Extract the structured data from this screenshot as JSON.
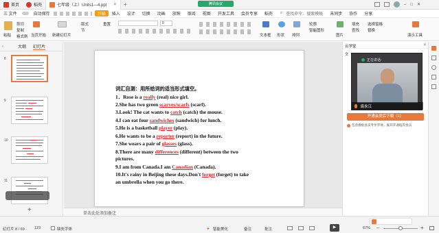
{
  "titlebar": {
    "tabs": [
      {
        "label": "首页",
        "color": "#d33b2f"
      },
      {
        "label": "稻壳",
        "color": "#d33b2f"
      },
      {
        "label": "七年级（上）Units1—4.ppt",
        "color": "#e8793a"
      }
    ],
    "meeting_label": "腾讯会议",
    "login_label": "登录"
  },
  "menubar": {
    "file": "三 文件",
    "quick_tools": "自动保存",
    "items": [
      "开始",
      "插入",
      "设计",
      "切换",
      "动画",
      "放映",
      "审阅",
      "视图",
      "开发工具",
      "会员专享",
      "稻壳"
    ],
    "active": "开始",
    "search": "查找命令、搜索模板",
    "unsync": "未同步",
    "collab": "协作",
    "share": "分享"
  },
  "ribbon": {
    "paste": "粘贴",
    "cut": "剪切",
    "copy": "复制",
    "format_painter": "格式刷",
    "from_current": "当页开始",
    "new_slide": "新建幻灯片",
    "layout": "版式",
    "section": "节",
    "reset": "重置",
    "font_name": "",
    "font_size": "0",
    "text_box": "文本框",
    "shape": "形状",
    "arrange": "排列",
    "outline": "轮廓",
    "smart_shape": "智能图形",
    "picture": "图片",
    "fill": "填充",
    "select_tool": "选择窗格",
    "replace": "替换",
    "assistant": "演示工具",
    "find": "查找"
  },
  "leftpanel": {
    "tabs": [
      "大纲",
      "幻灯片"
    ],
    "thumb_numbers": [
      "8",
      "9",
      "10",
      "11"
    ],
    "add_label": "+",
    "bottom_note": "添加备注"
  },
  "slide": {
    "title": "词汇自测：用所给词的适当形式填空。",
    "lines": [
      {
        "pre": "1．Rose is a ",
        "ans": "really",
        "post": " (real) nice girl."
      },
      {
        "pre": "2.She has two green ",
        "ans": "scarves/scarfs",
        "post": " (scarf)."
      },
      {
        "pre": "3.Look! The cat wants to ",
        "ans": "catch",
        "post": " (catch) the mouse."
      },
      {
        "pre": "4.I can eat four ",
        "ans": "sandwiches",
        "post": " (sandwich) for lunch."
      },
      {
        "pre": "5.He is a basketball ",
        "ans": "player",
        "post": " (play)."
      },
      {
        "pre": "6.He wants to be a ",
        "ans": "reporter",
        "post": " (report) in the future."
      },
      {
        "pre": "7.She wears a pair of ",
        "ans": "glasses",
        "post": " (glass)."
      },
      {
        "pre": "8.There are many ",
        "ans": "differences",
        "post": " (different) between the two"
      },
      {
        "pre": "   pictures.",
        "ans": "",
        "post": ""
      },
      {
        "pre": "9.I am from Canada.I am ",
        "ans": "Canadian",
        "post": " (Canada)."
      },
      {
        "pre": "10.It's rainy in Beijing these days.Don't ",
        "ans": "forget",
        "post": " (forget) to take"
      },
      {
        "pre": "   an umbrella when you go there.",
        "ans": "",
        "post": ""
      }
    ]
  },
  "canvas": {
    "notes_placeholder": "单击此处添加备注"
  },
  "rightpanel": {
    "header": "云学堂",
    "speaking_label": "正在讲话:",
    "speaker_name": "庞永江",
    "download_button": "开通会员后下载（1）",
    "vip_tip": "包含模板会员专享字体，展开开通稻壳会员",
    "side_label": "文"
  },
  "status": {
    "slide_count": "幻灯片 8 / 69",
    "page_num": "123",
    "missing_font": "缺失字体",
    "smart_beautify": "智能美化",
    "notes": "备注",
    "comments": "批注",
    "zoom": "67%",
    "play": "▶"
  },
  "colors": {
    "accent": "#e8793a",
    "wps_red": "#d33b2f",
    "answer_red": "#e02020",
    "meeting_green": "#27a86a"
  }
}
